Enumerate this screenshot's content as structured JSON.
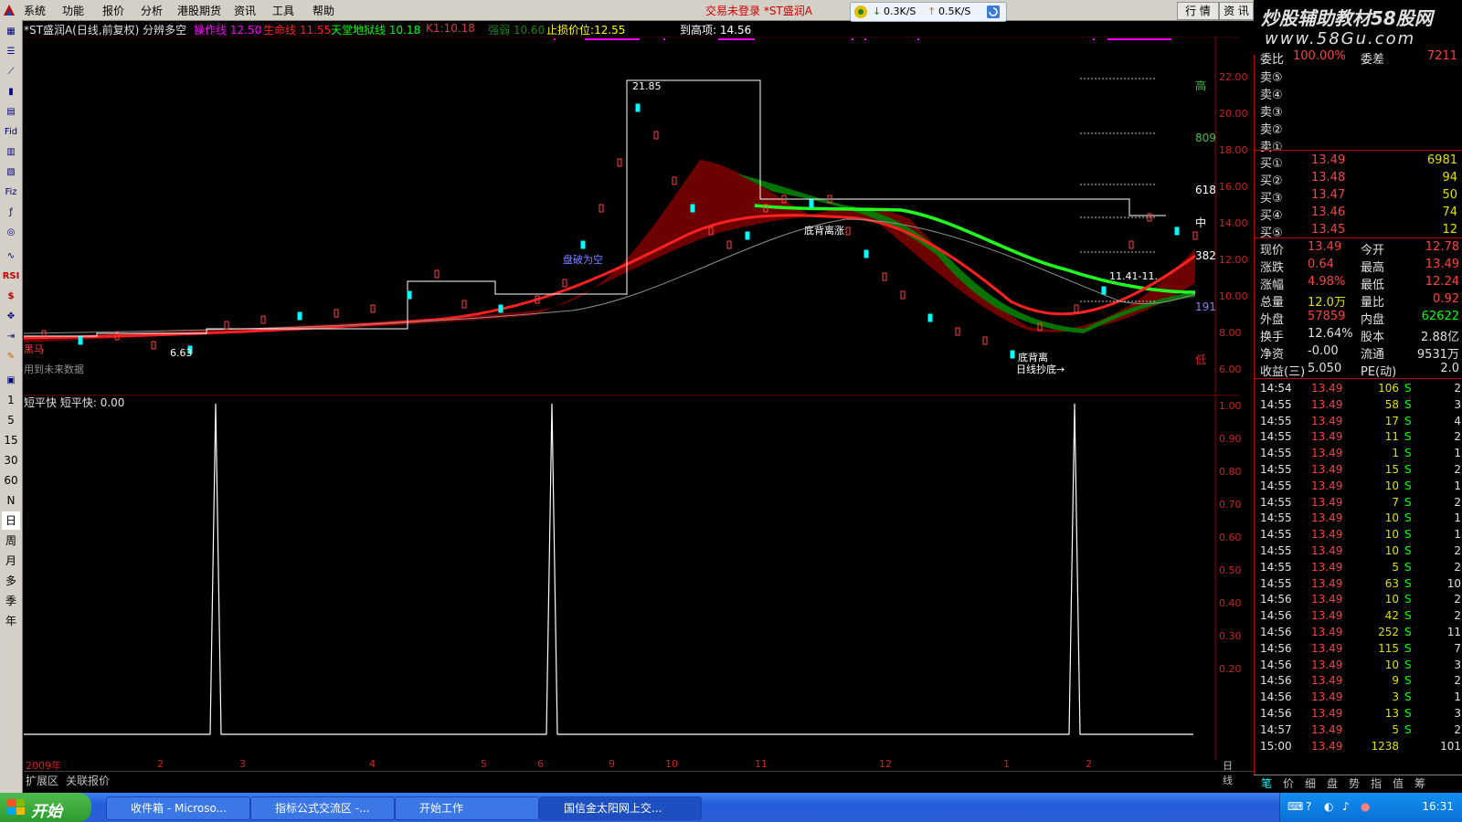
{
  "menu": [
    "系统",
    "功能",
    "报价",
    "分析",
    "港股期货",
    "资讯",
    "工具",
    "帮助"
  ],
  "trade_alert": "交易未登录 *ST盛润A",
  "net": {
    "down": "0.3K/S",
    "up": "0.5K/S"
  },
  "top_tabs": [
    "行 情",
    "资 讯"
  ],
  "watermark": {
    "line1": "炒股辅助教材58股网",
    "line2": "www.58Gu.com"
  },
  "left_tools": [
    "Fid",
    "Fiz",
    "RSI",
    "$"
  ],
  "periods": [
    "1",
    "5",
    "15",
    "30",
    "60",
    "N",
    "日",
    "周",
    "月",
    "多",
    "季",
    "年"
  ],
  "header": {
    "title": "*ST盛润A(日线,前复权) 分辨多空",
    "items": [
      {
        "label": "操作线",
        "value": "12.50",
        "color": "#ff00ff"
      },
      {
        "label": "生命线",
        "value": "11.55",
        "color": "#ff2020"
      },
      {
        "label": "天堂地狱线",
        "value": "10.18",
        "color": "#00ff00"
      },
      {
        "label": "K1",
        "value": "10.18",
        "color": "#d04040"
      },
      {
        "label": "强弱",
        "value": "10.60",
        "color": "#208020"
      },
      {
        "label": "止损价位",
        "value": "12.55",
        "color": "#ffff00"
      },
      {
        "label": "到高项",
        "value": "14.56",
        "color": "#ffffff"
      }
    ]
  },
  "price_axis": [
    "22.00",
    "20.00",
    "18.00",
    "16.00",
    "14.00",
    "12.00",
    "10.00",
    "8.00",
    "6.00"
  ],
  "annotations": {
    "peak": "21.85",
    "low": "6.63",
    "high_label": "高",
    "low_label": "低",
    "mid_label": "中",
    "fib809": "809",
    "fib618": "618",
    "fib382": "382",
    "fib191": "191",
    "bottom_div": "底背离",
    "bottom_buy": "日线抄底→",
    "range": "11.41-11.",
    "future": "用到未来数据",
    "dark_horse": "黑马",
    "breakthrough": "底背离涨",
    "bankrupt_short": "盘破为空"
  },
  "sub": {
    "title": "短平快",
    "label": "短平快",
    "value": "0.00",
    "axis": [
      "1.00",
      "0.90",
      "0.80",
      "0.70",
      "0.60",
      "0.50",
      "0.40",
      "0.30",
      "0.20"
    ]
  },
  "chart_data": {
    "type": "line",
    "title": "短平快",
    "ylim": [
      0,
      1
    ],
    "x": [
      "2009-01",
      "2009-02",
      "2009-03",
      "2009-04",
      "2009-05",
      "2009-06",
      "2009-08",
      "2009-09",
      "2009-10",
      "2009-11",
      "2009-12",
      "2010-01",
      "2010-02"
    ],
    "spikes_at": [
      "2009-02",
      "2009-08",
      "2010-01"
    ],
    "spike_value": 1.0
  },
  "dates": [
    "2009年",
    "2",
    "3",
    "4",
    "5",
    "6",
    "8",
    "9",
    "10",
    "11",
    "12",
    "1",
    "2"
  ],
  "period_label": "日线",
  "bottom_tabs": [
    "扩展区",
    "关联报价"
  ],
  "order_book": {
    "top_label": "委比",
    "top_value": "100.00%",
    "diff_label": "委差",
    "diff_value": "7211",
    "sell": [
      {
        "l": "卖⑤"
      },
      {
        "l": "卖④"
      },
      {
        "l": "卖③"
      },
      {
        "l": "卖②"
      },
      {
        "l": "卖①"
      }
    ],
    "buy": [
      {
        "l": "买①",
        "p": "13.49",
        "v": "6981"
      },
      {
        "l": "买②",
        "p": "13.48",
        "v": "94"
      },
      {
        "l": "买③",
        "p": "13.47",
        "v": "50"
      },
      {
        "l": "买④",
        "p": "13.46",
        "v": "74"
      },
      {
        "l": "买⑤",
        "p": "13.45",
        "v": "12"
      }
    ]
  },
  "stats": [
    {
      "l1": "现价",
      "v1": "13.49",
      "l2": "今开",
      "v2": "12.78",
      "c1": "#ff4040",
      "c2": "#ff4040"
    },
    {
      "l1": "涨跌",
      "v1": "0.64",
      "l2": "最高",
      "v2": "13.49",
      "c1": "#ff4040",
      "c2": "#ff4040"
    },
    {
      "l1": "涨幅",
      "v1": "4.98%",
      "l2": "最低",
      "v2": "12.24",
      "c1": "#ff4040",
      "c2": "#ff4040"
    },
    {
      "l1": "总量",
      "v1": "12.0万",
      "l2": "量比",
      "v2": "0.92",
      "c1": "#e0e000",
      "c2": "#ff4040"
    },
    {
      "l1": "外盘",
      "v1": "57859",
      "l2": "内盘",
      "v2": "62622",
      "c1": "#ff4040",
      "c2": "#00ff00"
    },
    {
      "l1": "换手",
      "v1": "12.64%",
      "l2": "股本",
      "v2": "2.88亿",
      "c1": "#e0e0e0",
      "c2": "#e0e0e0"
    },
    {
      "l1": "净资",
      "v1": "-0.00",
      "l2": "流通",
      "v2": "9531万",
      "c1": "#e0e0e0",
      "c2": "#e0e0e0"
    },
    {
      "l1": "收益(三)",
      "v1": "5.050",
      "l2": "PE(动)",
      "v2": "2.0",
      "c1": "#e0e0e0",
      "c2": "#e0e0e0"
    }
  ],
  "ticks": [
    {
      "t": "14:54",
      "p": "13.49",
      "v": "106",
      "s": "S",
      "n": "2"
    },
    {
      "t": "14:55",
      "p": "13.49",
      "v": "58",
      "s": "S",
      "n": "3"
    },
    {
      "t": "14:55",
      "p": "13.49",
      "v": "17",
      "s": "S",
      "n": "4"
    },
    {
      "t": "14:55",
      "p": "13.49",
      "v": "11",
      "s": "S",
      "n": "2"
    },
    {
      "t": "14:55",
      "p": "13.49",
      "v": "1",
      "s": "S",
      "n": "1"
    },
    {
      "t": "14:55",
      "p": "13.49",
      "v": "15",
      "s": "S",
      "n": "2"
    },
    {
      "t": "14:55",
      "p": "13.49",
      "v": "10",
      "s": "S",
      "n": "1"
    },
    {
      "t": "14:55",
      "p": "13.49",
      "v": "7",
      "s": "S",
      "n": "2"
    },
    {
      "t": "14:55",
      "p": "13.49",
      "v": "10",
      "s": "S",
      "n": "1"
    },
    {
      "t": "14:55",
      "p": "13.49",
      "v": "10",
      "s": "S",
      "n": "1"
    },
    {
      "t": "14:55",
      "p": "13.49",
      "v": "10",
      "s": "S",
      "n": "2"
    },
    {
      "t": "14:55",
      "p": "13.49",
      "v": "5",
      "s": "S",
      "n": "2"
    },
    {
      "t": "14:55",
      "p": "13.49",
      "v": "63",
      "s": "S",
      "n": "10"
    },
    {
      "t": "14:56",
      "p": "13.49",
      "v": "10",
      "s": "S",
      "n": "2"
    },
    {
      "t": "14:56",
      "p": "13.49",
      "v": "42",
      "s": "S",
      "n": "2"
    },
    {
      "t": "14:56",
      "p": "13.49",
      "v": "252",
      "s": "S",
      "n": "11"
    },
    {
      "t": "14:56",
      "p": "13.49",
      "v": "115",
      "s": "S",
      "n": "7"
    },
    {
      "t": "14:56",
      "p": "13.49",
      "v": "10",
      "s": "S",
      "n": "3"
    },
    {
      "t": "14:56",
      "p": "13.49",
      "v": "9",
      "s": "S",
      "n": "2"
    },
    {
      "t": "14:56",
      "p": "13.49",
      "v": "3",
      "s": "S",
      "n": "1"
    },
    {
      "t": "14:56",
      "p": "13.49",
      "v": "13",
      "s": "S",
      "n": "3"
    },
    {
      "t": "14:57",
      "p": "13.49",
      "v": "5",
      "s": "S",
      "n": "2"
    },
    {
      "t": "15:00",
      "p": "13.49",
      "v": "1238",
      "s": "",
      "n": "101"
    }
  ],
  "rp_tabs": [
    "笔",
    "价",
    "细",
    "盘",
    "势",
    "指",
    "值",
    "筹"
  ],
  "taskbar": {
    "start": "开始",
    "tasks": [
      "收件箱 - Microso...",
      "指标公式交流区 -...",
      "开始工作",
      "国信金太阳网上交..."
    ],
    "clock": "16:31"
  }
}
